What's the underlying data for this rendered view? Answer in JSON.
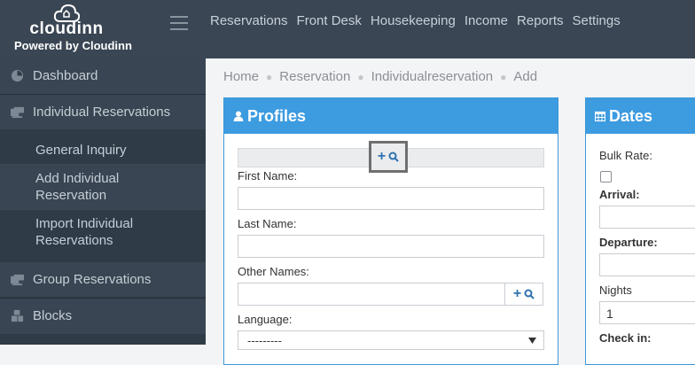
{
  "brand": {
    "name": "cloudinn",
    "powered_by": "Powered by Cloudinn"
  },
  "topnav": [
    "Reservations",
    "Front Desk",
    "Housekeeping",
    "Income",
    "Reports",
    "Settings"
  ],
  "sidebar": {
    "dashboard": "Dashboard",
    "individual": "Individual Reservations",
    "sub": [
      "General Inquiry",
      "Add Individual Reservation",
      "Import Individual Reservations"
    ],
    "group": "Group Reservations",
    "blocks": "Blocks"
  },
  "breadcrumb": [
    "Home",
    "Reservation",
    "Individualreservation",
    "Add"
  ],
  "profiles": {
    "title": "Profiles",
    "first_name": "First Name:",
    "last_name": "Last Name:",
    "other_names": "Other Names:",
    "language": "Language:",
    "language_value": "---------"
  },
  "dates": {
    "title": "Dates",
    "bulk_rate": "Bulk Rate:",
    "arrival": "Arrival:",
    "departure": "Departure:",
    "nights": "Nights",
    "nights_value": "1",
    "check_in": "Check in:"
  },
  "colors": {
    "topbar": "#3a4654",
    "sidebar": "#2f3b47",
    "panel_header": "#3d9be0",
    "action_icon": "#2f72b0"
  },
  "icons": [
    "cloud-logo-icon",
    "menu-icon",
    "dashboard-icon",
    "reservation-icon",
    "group-icon",
    "blocks-icon",
    "user-icon",
    "calendar-icon",
    "plus-icon",
    "search-icon",
    "chevron-down-icon"
  ]
}
